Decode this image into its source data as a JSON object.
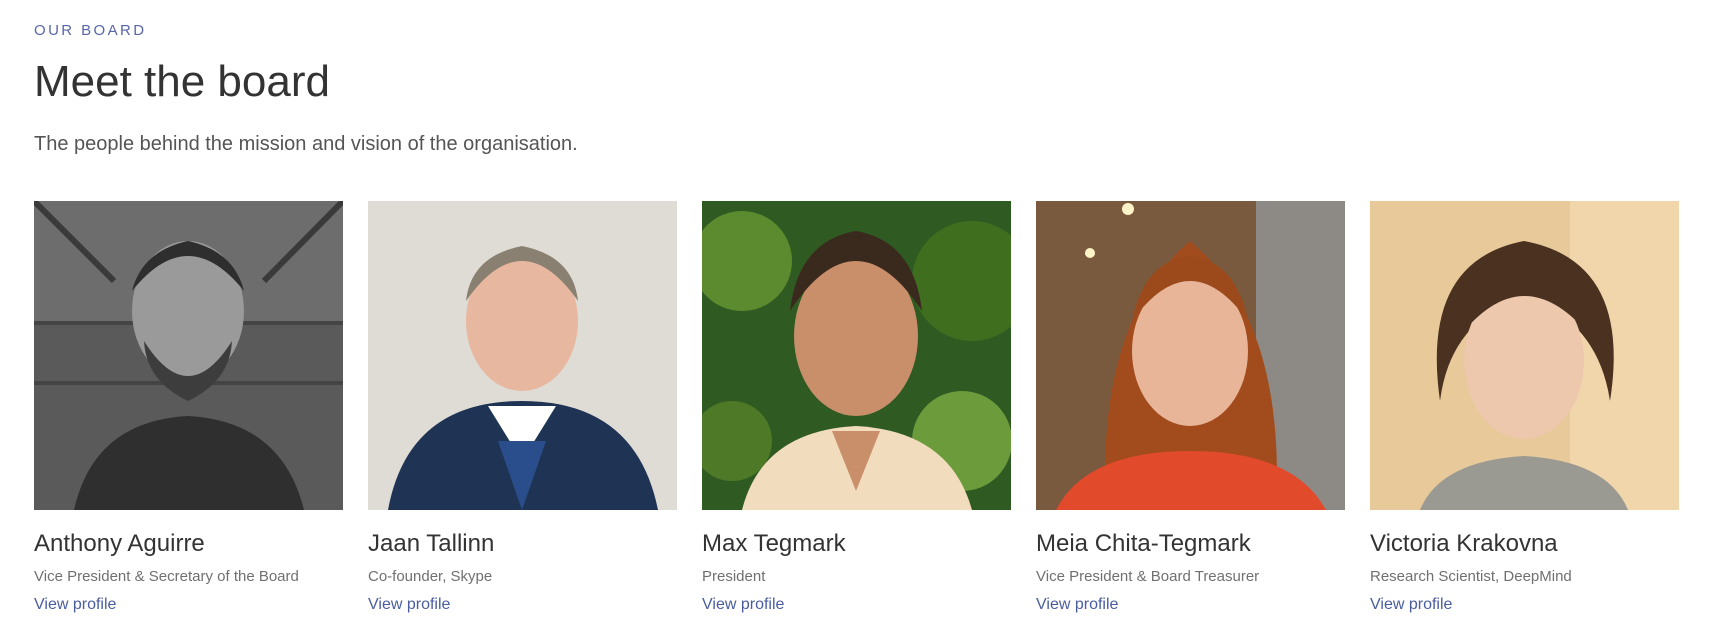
{
  "section": {
    "eyebrow": "OUR BOARD",
    "title": "Meet the board",
    "subtitle": "The people behind the mission and vision of the organisation."
  },
  "board": [
    {
      "name": "Anthony Aguirre",
      "role": "Vice President & Secretary of the Board",
      "link_label": "View profile"
    },
    {
      "name": "Jaan Tallinn",
      "role": "Co-founder, Skype",
      "link_label": "View profile"
    },
    {
      "name": "Max Tegmark",
      "role": "President",
      "link_label": "View profile"
    },
    {
      "name": "Meia Chita-Tegmark",
      "role": "Vice President & Board Treasurer",
      "link_label": "View profile"
    },
    {
      "name": "Victoria Krakovna",
      "role": "Research Scientist, DeepMind",
      "link_label": "View profile"
    }
  ],
  "colors": {
    "eyebrow": "#5867a6",
    "link": "#4a5d9f",
    "heading": "#333333",
    "muted": "#707070"
  }
}
